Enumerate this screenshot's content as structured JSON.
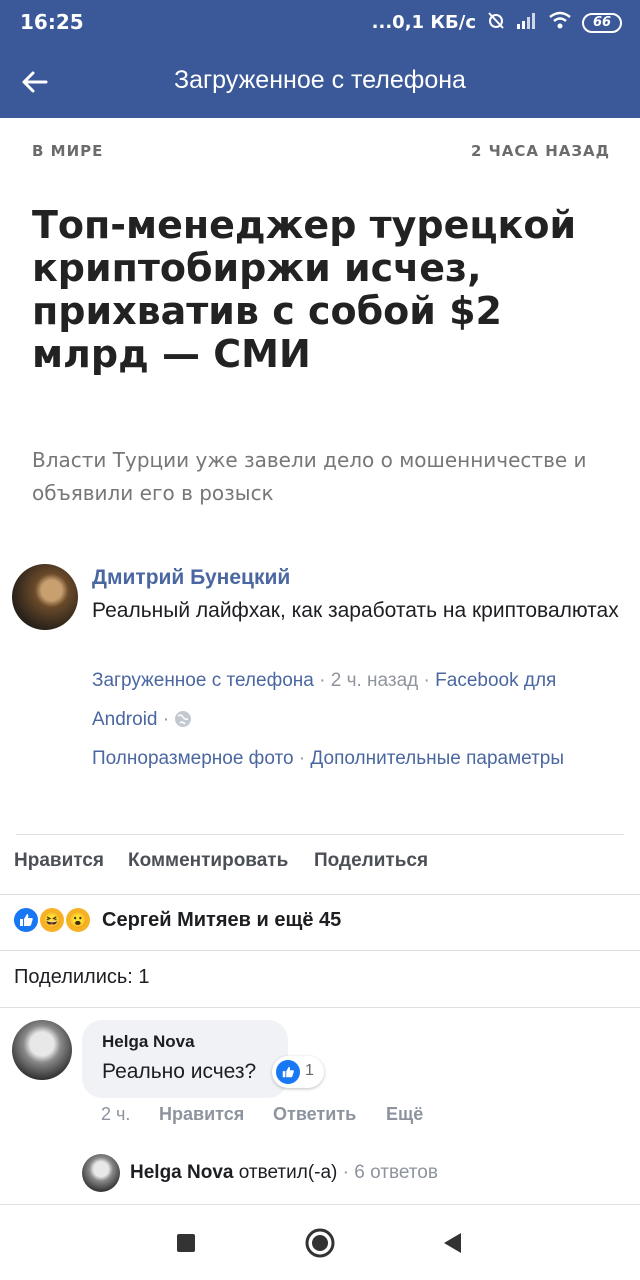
{
  "status_bar": {
    "time": "16:25",
    "network_speed": "...0,1 КБ/с",
    "battery": "66"
  },
  "app_bar": {
    "title": "Загруженное с телефона"
  },
  "article": {
    "category": "В МИРЕ",
    "time": "2 ЧАСА НАЗАД",
    "title": "Топ-менеджер турецкой криптобиржи исчез, прихватив с собой $2 млрд — СМИ",
    "lead": "Власти Турции уже завели дело о мошенничестве и объявили его в розыск"
  },
  "post": {
    "author": "Дмитрий Бунецкий",
    "text": "Реальный лайфхак, как заработать на криптовалютах",
    "album": "Загруженное с телефона",
    "time": "2 ч. назад",
    "app_part1": "Facebook для",
    "app_part2": "Android",
    "full_photo": "Полноразмерное фото",
    "more_options": "Дополнительные параметры",
    "sep": "·"
  },
  "actions": {
    "like": "Нравится",
    "comment": "Комментировать",
    "share": "Поделиться"
  },
  "reactions": {
    "text": "Сергей Митяев и ещё 45",
    "icons": [
      "like-icon",
      "haha-icon",
      "wow-icon"
    ]
  },
  "shares": {
    "text": "Поделились: 1"
  },
  "comment": {
    "author": "Helga Nova",
    "text": "Реально исчез?",
    "likes": "1",
    "time": "2 ч.",
    "like": "Нравится",
    "reply": "Ответить",
    "more": "Ещё"
  },
  "reply_summary": {
    "name": "Helga Nova",
    "verb": "ответил(-а)",
    "sep": "·",
    "count": "6 ответов"
  },
  "colors": {
    "brand": "#3b5998",
    "link": "#4b67a1",
    "like_blue": "#1877f2"
  }
}
